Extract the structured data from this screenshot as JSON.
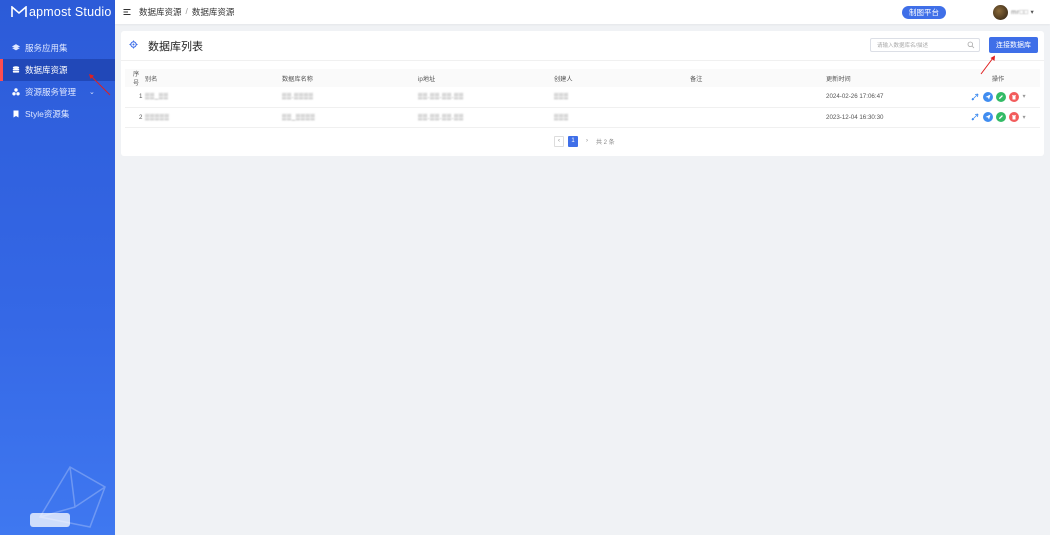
{
  "app": {
    "title": "apmost Studio",
    "brand_color": "#3f6fe8"
  },
  "sidebar": {
    "items": [
      {
        "label": "服务应用集",
        "icon": "layers-icon"
      },
      {
        "label": "数据库资源",
        "icon": "database-icon",
        "active": true
      },
      {
        "label": "资源服务管理",
        "icon": "cluster-icon"
      },
      {
        "label": "Style资源集",
        "icon": "bookmark-icon"
      }
    ]
  },
  "topbar": {
    "breadcrumb": [
      "数据库资源",
      "/",
      "数据库资源"
    ],
    "platform_button": "制图平台",
    "username": "mr□□"
  },
  "card": {
    "title": "数据库列表",
    "search_placeholder": "请输入数据库名/描述",
    "connect_button": "连接数据库"
  },
  "table": {
    "headers": [
      "序号",
      "别名",
      "数据库名称",
      "ip地址",
      "创建人",
      "备注",
      "更新时间",
      "操作"
    ],
    "rows": [
      {
        "index": "1",
        "alias": "▒▒_▒▒",
        "db_name": "▒▒.▒▒▒▒",
        "ip": "▒▒.▒▒.▒▒.▒▒",
        "creator": "▒▒▒",
        "remark": "",
        "updated": "2024-02-26 17:06:47"
      },
      {
        "index": "2",
        "alias": "▒▒▒▒▒",
        "db_name": "▒▒_▒▒▒▒",
        "ip": "▒▒.▒▒.▒▒.▒▒",
        "creator": "▒▒▒",
        "remark": "",
        "updated": "2023-12-04 16:30:30"
      }
    ]
  },
  "pagination": {
    "current": "1",
    "total_label": "共 2 条"
  }
}
